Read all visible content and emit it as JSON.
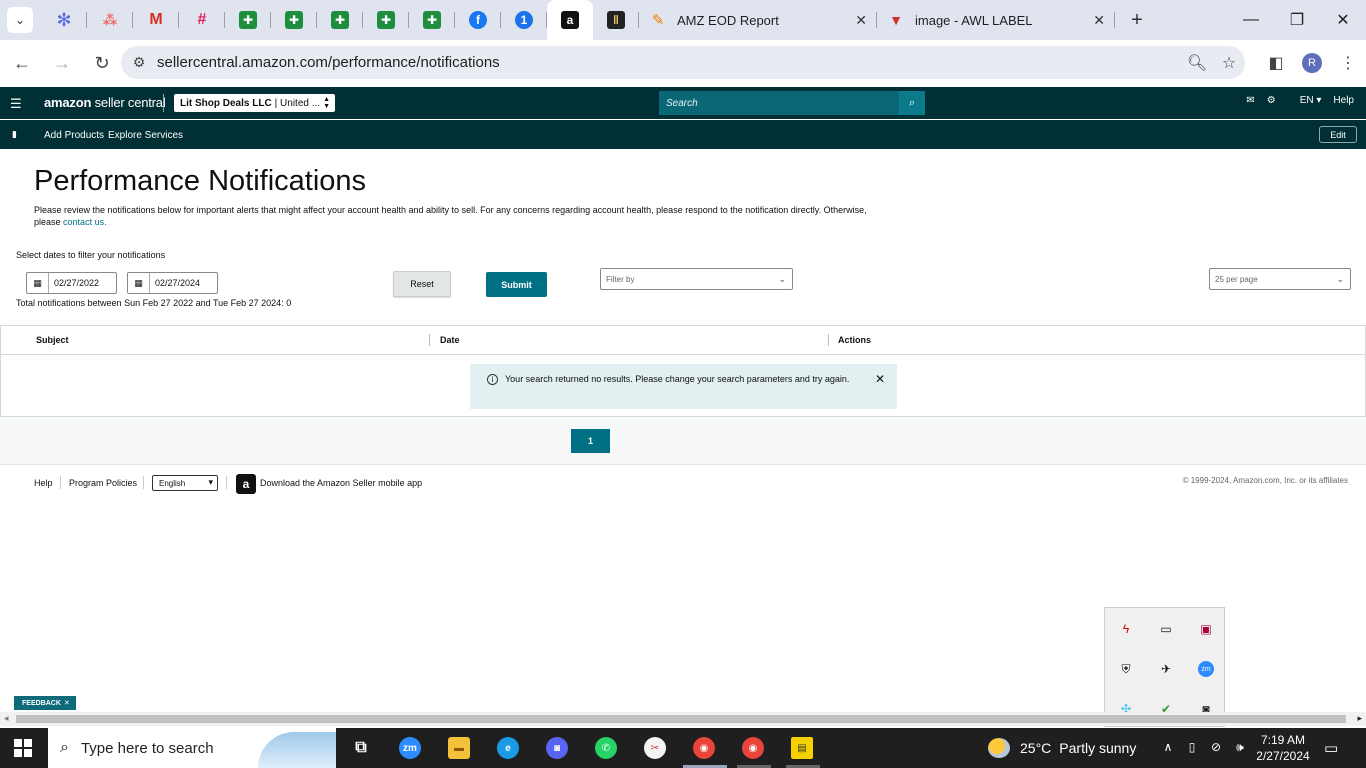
{
  "browser": {
    "tabs": [
      {
        "title": "AMZ EOD Report",
        "icon": "pencil-icon"
      },
      {
        "title": "image - AWL LABEL",
        "icon": "awl-icon"
      }
    ],
    "url": "sellercentral.amazon.com/performance/notifications",
    "profile_initial": "R"
  },
  "header": {
    "logo_bold": "amazon",
    "logo_rest": "seller central",
    "account_name": "Lit Shop Deals LLC",
    "account_region": "| United ...",
    "search_placeholder": "Search",
    "language": "EN",
    "help": "Help",
    "sub_links": [
      "Add Products",
      "Explore Services"
    ],
    "edit": "Edit"
  },
  "page": {
    "title": "Performance Notifications",
    "description": "Please review the notifications below for important alerts that might affect your account health and ability to sell. For any concerns regarding account health, please respond to the notification directly. Otherwise, please",
    "contact_link": "contact us.",
    "filter_label": "Select dates to filter your notifications",
    "start_date": "02/27/2022",
    "end_date": "02/27/2024",
    "reset": "Reset",
    "submit": "Submit",
    "filter_placeholder": "Filter by",
    "per_page": "25 per page",
    "total": "Total notifications between Sun Feb 27 2022 and Tue Feb 27 2024: 0",
    "columns": [
      "Subject",
      "Date",
      "Actions"
    ],
    "no_results": "Your search returned no results. Please change your search parameters and try again.",
    "current_page": "1"
  },
  "footer": {
    "help": "Help",
    "policies": "Program Policies",
    "language": "English",
    "app_link": "Download the Amazon Seller mobile app",
    "copyright": "© 1999-2024, Amazon.com, Inc. or its affiliates"
  },
  "feedback": "FEEDBACK",
  "taskbar": {
    "search_placeholder": "Type here to search",
    "weather_temp": "25°C",
    "weather_desc": "Partly sunny",
    "time": "7:19 AM",
    "date": "2/27/2024"
  }
}
